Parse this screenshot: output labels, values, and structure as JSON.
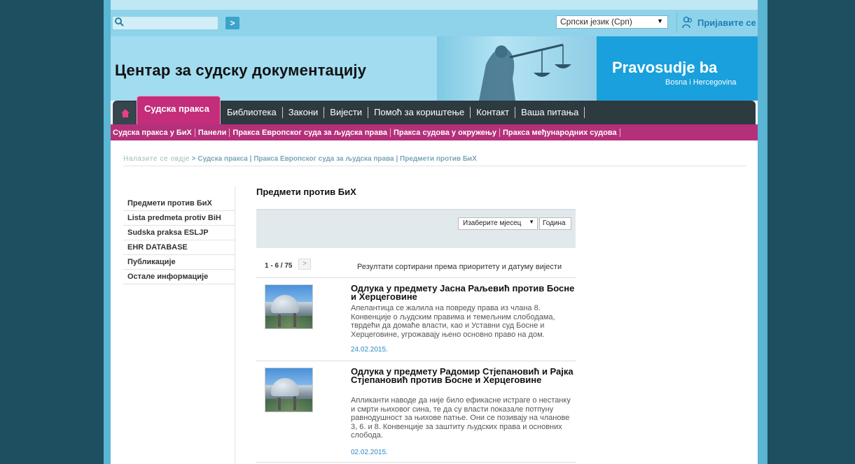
{
  "search": {
    "placeholder": "",
    "go_label": ">"
  },
  "language": {
    "selected": "Српски језик (Срп)"
  },
  "login": {
    "label": "Пријавите се"
  },
  "site_title": "Центар за судску документацију",
  "logo": {
    "main": "Pravosudje ba",
    "sub": "Bosna i Hercegovina"
  },
  "nav": {
    "active": "Судска пракса",
    "items": [
      "Библиотека",
      "Закони",
      "Вијести",
      "Помоћ за кориштење",
      "Контакт",
      "Ваша питања"
    ]
  },
  "subnav": {
    "items": [
      "Судска пракса у БиХ",
      "Панели",
      "Пракса Европског суда за људска права",
      "Пракса судова у окружењу",
      "Пракса међународних судова"
    ]
  },
  "breadcrumb": {
    "prefix": "Налазите се овдје",
    "path": "> Судска пракса | Пракса Европског суда за људска права | Предмети против БиХ"
  },
  "leftnav": {
    "items": [
      "Предмети против БиХ",
      "Lista predmeta protiv BiH",
      "Sudska praksa ESLJP",
      "EHR DATABASE",
      "Публикације",
      "Остале информације"
    ]
  },
  "main": {
    "title": "Предмети против БиХ",
    "month_select": "Изаберите мјесец",
    "year_placeholder": "Година",
    "pager": "1 - 6 / 75",
    "pager_next": ">",
    "sort_note": "Резултати сортирани према приоритету и датуму вијести"
  },
  "articles": [
    {
      "title": "Одлука у предмету Јасна Раљевић против Босне и Херцеговине",
      "body": "Апелантица се жалила на повреду права из члана 8. Конвенције о људским правима и темељним слободама, тврдећи да домаће власти, као и Уставни суд Босне и Херцеговине, угрожавају њено основно право на дом.",
      "date": "24.02.2015."
    },
    {
      "title": "Одлука у предмету Радомир Стјепановић и Рајка Стјепановић против Босне и Херцеговине",
      "body": "Апликанти наводе да није било ефикасне истраге о нестанку и смрти њиховог сина, те да су власти показале потпуну равнодушност за њихове патње. Они се позивају на чланове 3, 6. и 8. Конвенције за заштиту људских права и основних слобода.",
      "date": "02.02.2015."
    }
  ],
  "colors": {
    "accent": "#c32d7a",
    "nav_dark": "#2d3a40",
    "sky": "#a2dcf0",
    "link": "#2a8ac0"
  }
}
